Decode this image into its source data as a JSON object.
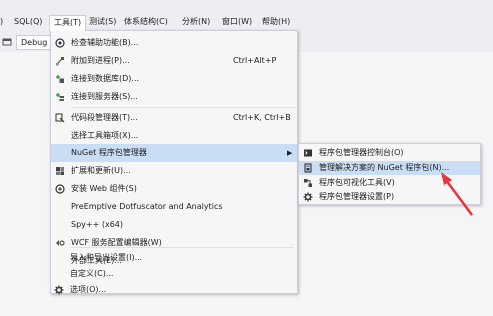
{
  "menubar": {
    "items": [
      {
        "label": ")"
      },
      {
        "label": "SQL(Q)"
      },
      {
        "label": "工具(T)"
      },
      {
        "label": "测试(S)"
      },
      {
        "label": "体系结构(C)"
      },
      {
        "label": "分析(N)"
      },
      {
        "label": "窗口(W)"
      },
      {
        "label": "帮助(H)"
      }
    ]
  },
  "toolbar": {
    "config": "Debug"
  },
  "tools_menu": {
    "items": [
      {
        "label": "检查辅助功能(B)...",
        "icon": "accessibility-icon",
        "shortcut": ""
      },
      {
        "label": "附加到进程(P)...",
        "icon": "attach-process-icon",
        "shortcut": "Ctrl+Alt+P"
      },
      {
        "label": "连接到数据库(D)...",
        "icon": "connect-database-icon",
        "shortcut": ""
      },
      {
        "label": "连接到服务器(S)...",
        "icon": "connect-server-icon",
        "shortcut": ""
      },
      {
        "label": "代码段管理器(T)...",
        "icon": "code-snippet-icon",
        "shortcut": "Ctrl+K, Ctrl+B"
      },
      {
        "label": "选择工具箱项(X)...",
        "icon": "",
        "shortcut": ""
      },
      {
        "label": "外接程序管理器(A)...",
        "icon": "",
        "shortcut": ""
      },
      {
        "label": "NuGet 程序包管理器",
        "icon": "",
        "shortcut": ""
      },
      {
        "label": "扩展和更新(U)...",
        "icon": "extensions-icon",
        "shortcut": ""
      },
      {
        "label": "安装 Web 组件(S)",
        "icon": "web-platform-icon",
        "shortcut": ""
      },
      {
        "label": "PreEmptive Dotfuscator and Analytics",
        "icon": "",
        "shortcut": ""
      },
      {
        "label": "Spy++ (x64)",
        "icon": "",
        "shortcut": ""
      },
      {
        "label": "WCF 服务配置编辑器(W)",
        "icon": "wcf-config-icon",
        "shortcut": ""
      },
      {
        "label": "外部工具(E)...",
        "icon": "",
        "shortcut": ""
      },
      {
        "label": "导入和导出设置(I)...",
        "icon": "",
        "shortcut": ""
      },
      {
        "label": "自定义(C)...",
        "icon": "",
        "shortcut": ""
      },
      {
        "label": "选项(O)...",
        "icon": "gear-icon",
        "shortcut": ""
      }
    ]
  },
  "nuget_submenu": {
    "items": [
      {
        "label": "程序包管理器控制台(O)",
        "icon": "console-icon"
      },
      {
        "label": "管理解决方案的 NuGet 程序包(N)...",
        "icon": "nuget-package-icon"
      },
      {
        "label": "程序包可视化工具(V)",
        "icon": "visualizer-icon"
      },
      {
        "label": "程序包管理器设置(P)",
        "icon": "gear-icon"
      }
    ]
  },
  "colors": {
    "menubar_bg": "#eeeef2",
    "highlight": "#c9def5",
    "annotation_arrow": "#e8343b"
  }
}
